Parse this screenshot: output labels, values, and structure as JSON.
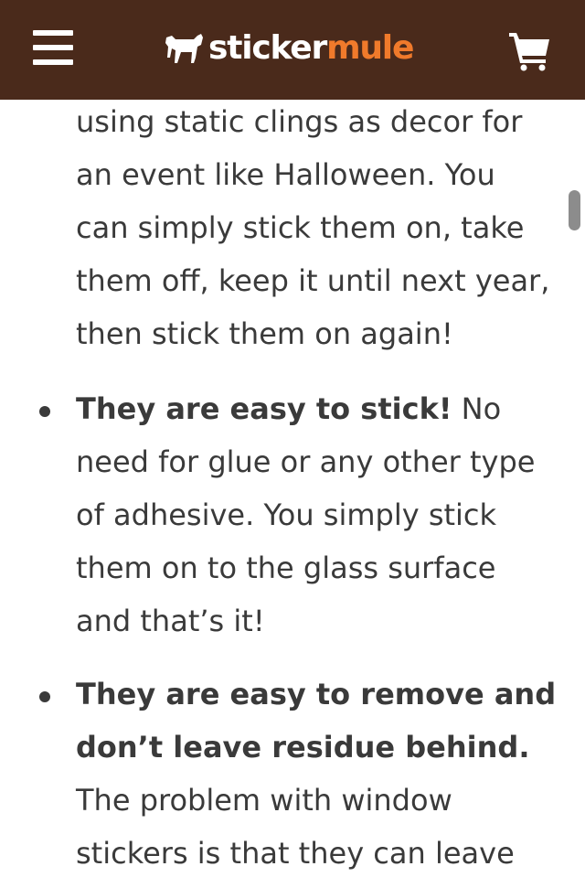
{
  "header": {
    "logo_sticker": "sticker",
    "logo_mule": "mule",
    "menu_icon": "hamburger-menu-icon",
    "cart_icon": "shopping-cart-icon",
    "colors": {
      "background": "#4a2a1b",
      "logo_accent": "#f07a2b",
      "logo_white": "#ffffff"
    }
  },
  "article": {
    "intro_lines": [
      "using static clings as decor for",
      "an event like Halloween. You",
      "can simply stick them on, take",
      "them off, keep it until next year,",
      "then stick them on again!"
    ],
    "bullets": [
      {
        "bold_lines": [
          "They are easy to stick!"
        ],
        "first_line_rest": " No",
        "lines": [
          "need for glue or any other type",
          "of adhesive. You simply stick",
          "them on to the glass surface",
          "and that’s it!"
        ]
      },
      {
        "bold_lines": [
          "They are easy to remove and",
          "don’t leave residue behind."
        ],
        "first_line_rest": "",
        "lines": [
          "The problem with window",
          "stickers is that they can leave"
        ]
      }
    ]
  }
}
